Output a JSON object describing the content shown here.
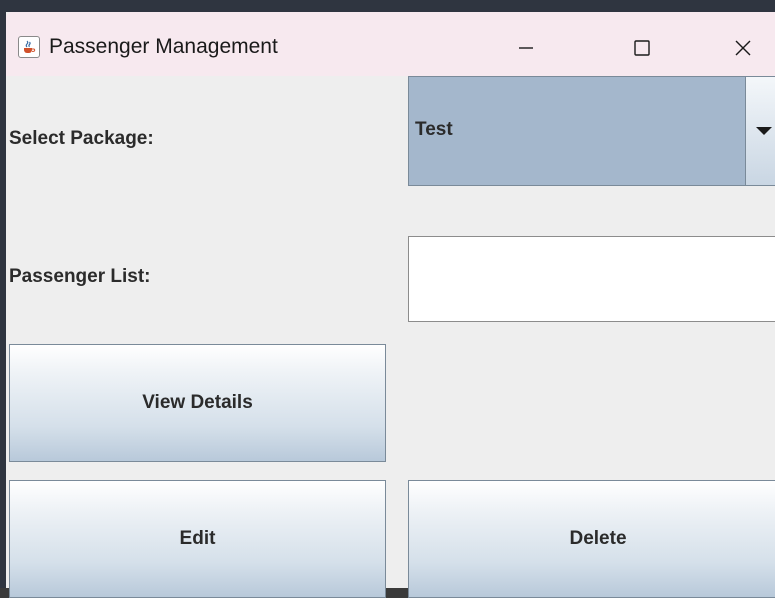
{
  "window": {
    "title": "Passenger Management",
    "icon": "java-cup-icon",
    "controls": [
      "minimize-icon",
      "maximize-icon",
      "close-icon"
    ]
  },
  "form": {
    "package_label": "Select Package:",
    "package_selected": "Test",
    "passenger_list_label": "Passenger List:",
    "passenger_list_items": []
  },
  "buttons": {
    "view_details": "View Details",
    "edit": "Edit",
    "delete": "Delete"
  },
  "colors": {
    "title_bar": "#f7e9ef",
    "window_bg": "#eeeeee",
    "combo_selected_bg": "#a4b7cc",
    "button_gradient_end": "#b8c9da"
  }
}
